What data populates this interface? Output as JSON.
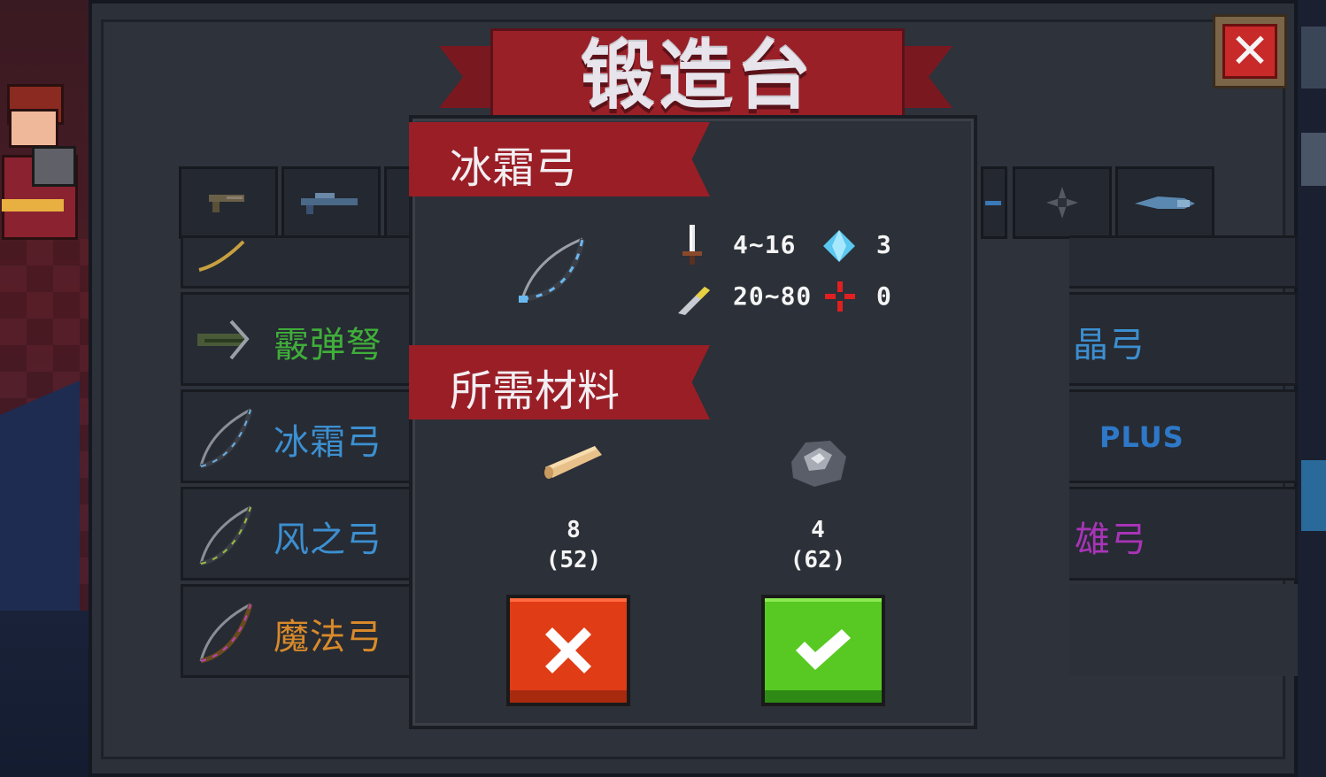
{
  "window": {
    "title": "锻造台",
    "close_icon": "close-icon"
  },
  "tabs": [
    {
      "icon": "pistol-icon"
    },
    {
      "icon": "rifle-icon"
    },
    {
      "icon": "partial-tab-icon"
    },
    {
      "icon": "fish-gun-icon"
    },
    {
      "icon": "shuriken-icon"
    },
    {
      "icon": "shark-gun-icon"
    }
  ],
  "weapon_list": [
    {
      "name": "霰弹弩",
      "color": "#3fae3a",
      "icon": "crossbow-icon"
    },
    {
      "name": "冰霜弓",
      "color": "#3c8fd0",
      "icon": "frost-bow-icon"
    },
    {
      "name": "风之弓",
      "color": "#3c8fd0",
      "icon": "wind-bow-icon"
    },
    {
      "name": "魔法弓",
      "color": "#d88a2a",
      "icon": "magic-bow-icon"
    }
  ],
  "weapon_list_right": [
    {
      "name": "晶弓",
      "color": "#3c8fd0"
    },
    {
      "name": "PLUS",
      "color": "#2e78c8"
    },
    {
      "name": "雄弓",
      "color": "#a834b8"
    }
  ],
  "detail": {
    "weapon_name": "冰霜弓",
    "stats": {
      "damage": "4~16",
      "energy_cost": "3",
      "charge": "20~80",
      "crit": "0"
    },
    "materials_title": "所需材料",
    "materials": [
      {
        "icon": "wood-icon",
        "required": "8",
        "owned": "(52)"
      },
      {
        "icon": "iron-ore-icon",
        "required": "4",
        "owned": "(62)"
      }
    ]
  }
}
